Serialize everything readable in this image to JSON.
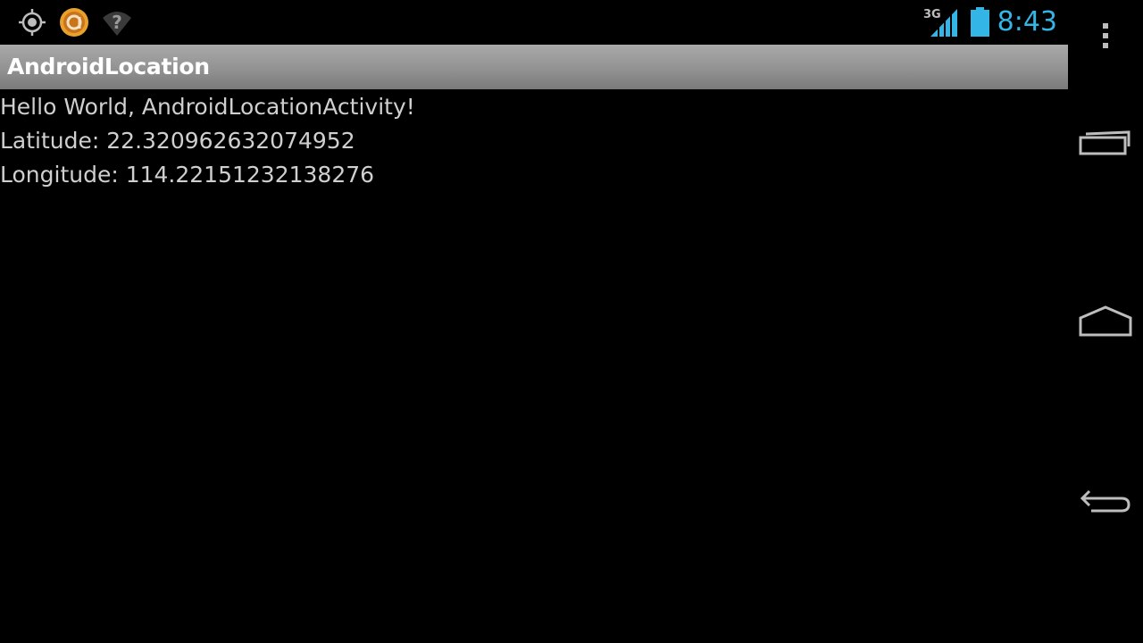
{
  "status_bar": {
    "icons": [
      "gps-icon",
      "app-notification-icon",
      "wifi-unknown-icon"
    ],
    "network_type": "3G",
    "clock": "8:43",
    "accent_color": "#33b5e5"
  },
  "action_bar": {
    "title": "AndroidLocation"
  },
  "content": {
    "greeting": "Hello World, AndroidLocationActivity!",
    "latitude": "Latitude: 22.320962632074952",
    "longitude": "Longitude: 114.22151232138276"
  },
  "nav_bar": {
    "buttons": [
      "overflow-menu",
      "recent-apps",
      "home",
      "back"
    ]
  }
}
